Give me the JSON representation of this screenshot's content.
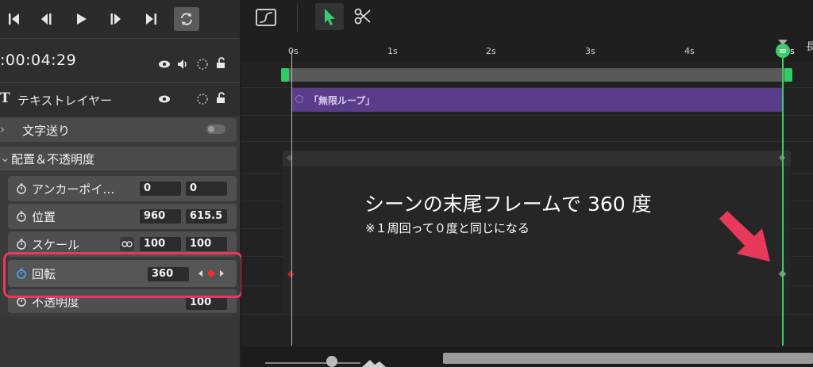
{
  "transport": {
    "buttons": [
      "skip-to-start",
      "step-back",
      "play",
      "step-forward",
      "skip-to-end",
      "loop"
    ]
  },
  "timecode": ":00:04:29",
  "layer": {
    "type_icon": "T",
    "name": "テキストレイヤー"
  },
  "sections": {
    "text_advance": "文字送り",
    "transform": "配置＆不透明度"
  },
  "properties": {
    "anchor": {
      "label": "アンカーポイ…",
      "x": "0",
      "y": "0"
    },
    "position": {
      "label": "位置",
      "x": "960",
      "y": "615.5"
    },
    "scale": {
      "label": "スケール",
      "x": "100",
      "y": "100"
    },
    "rotation": {
      "label": "回転",
      "value": "360"
    },
    "opacity": {
      "label": "不透明度",
      "value": "100"
    }
  },
  "ruler": {
    "ticks": [
      "0s",
      "1s",
      "2s",
      "3s",
      "4s",
      "5s"
    ],
    "right_cut": "長"
  },
  "clip": {
    "label": "「無限ループ」"
  },
  "annotation": {
    "title": "シーンの末尾フレームで 360 度",
    "subtitle": "※１周回って０度と同じになる"
  },
  "colors": {
    "accent": "#3dcc6b",
    "highlight": "#e8385c",
    "clip": "#5a3d8a"
  }
}
